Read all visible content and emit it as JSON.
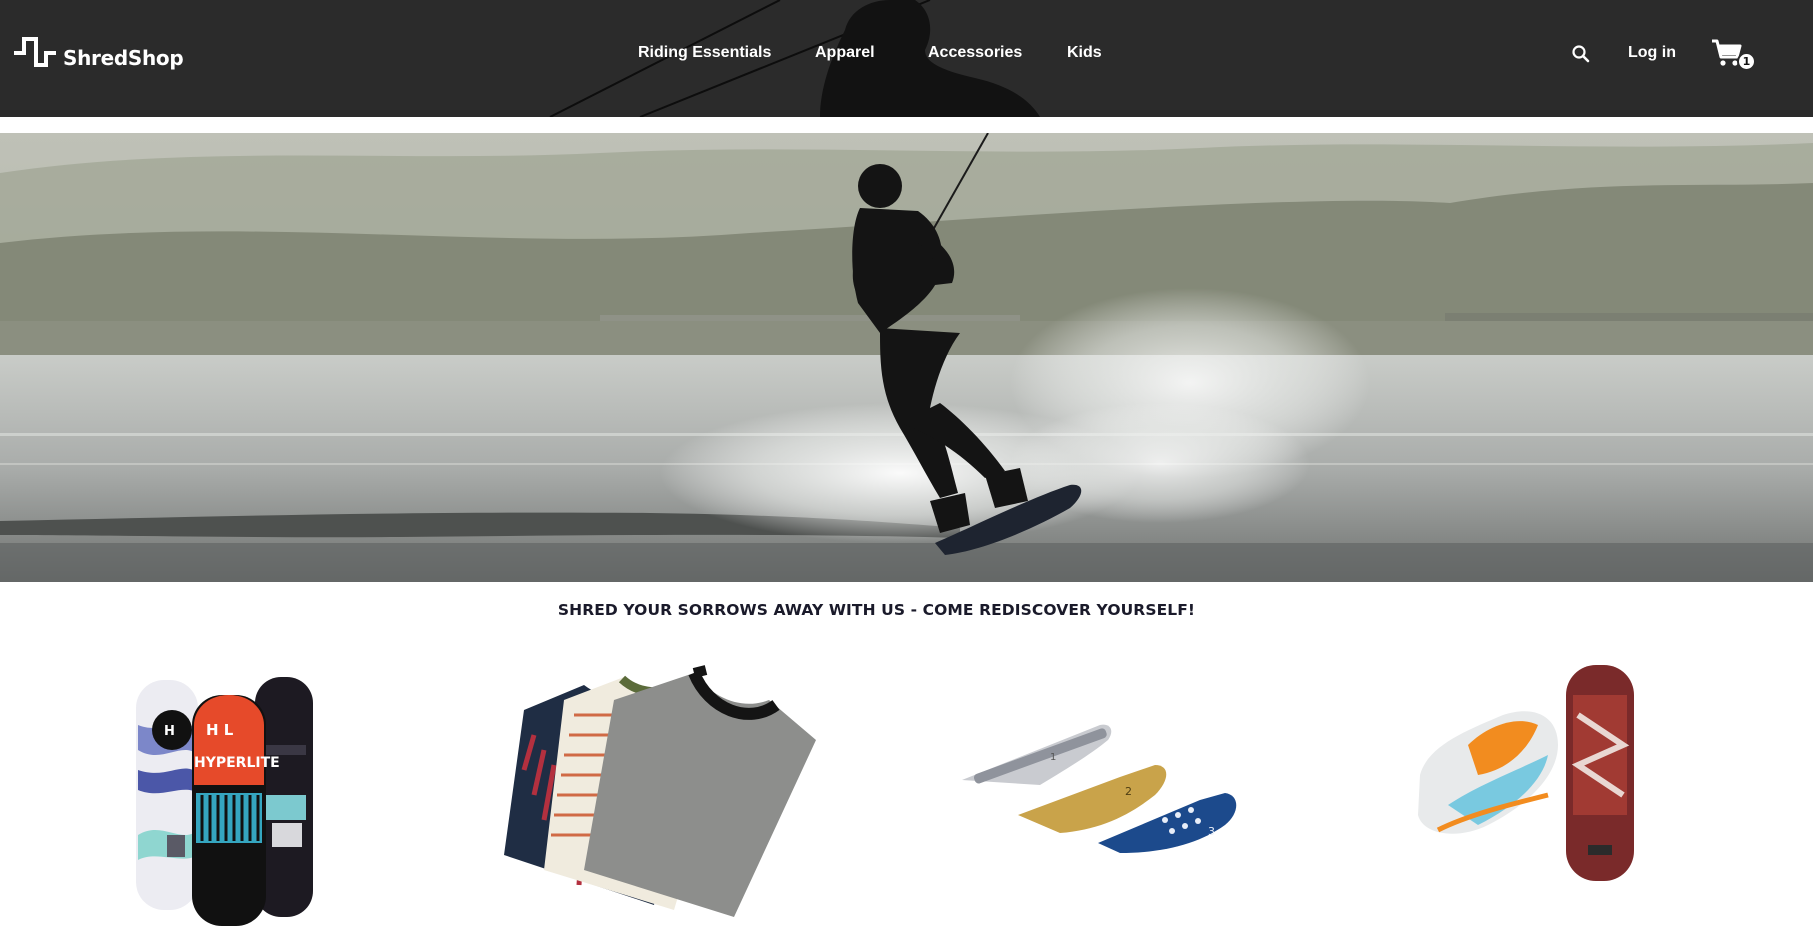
{
  "header": {
    "brand": "ShredShop",
    "nav": [
      {
        "label": "Riding Essentials"
      },
      {
        "label": "Apparel"
      },
      {
        "label": "Accessories"
      },
      {
        "label": "Kids"
      }
    ],
    "login_label": "Log in",
    "cart_count": "1",
    "icons": {
      "search": "search-icon",
      "cart": "cart-icon",
      "logo": "logo-icon"
    }
  },
  "hero": {
    "image": "wakeboarder-hero-image"
  },
  "tagline": "SHRED YOUR SORROWS AWAY WITH US - COME REDISCOVER YOURSELF!",
  "categories": [
    {
      "name": "riding-essentials",
      "image": "wakeboards-image",
      "board_text": "H L",
      "board_brand": "HYPERLITE"
    },
    {
      "name": "apparel",
      "image": "folded-tshirts-image"
    },
    {
      "name": "accessories",
      "image": "wakeboard-fins-image",
      "fin_labels": [
        "1",
        "2",
        "3"
      ]
    },
    {
      "name": "kids",
      "image": "kids-gear-image"
    }
  ],
  "colors": {
    "header_bg": "#2b2b2b",
    "text_on_dark": "#ffffff",
    "tagline": "#1a1a2a"
  }
}
